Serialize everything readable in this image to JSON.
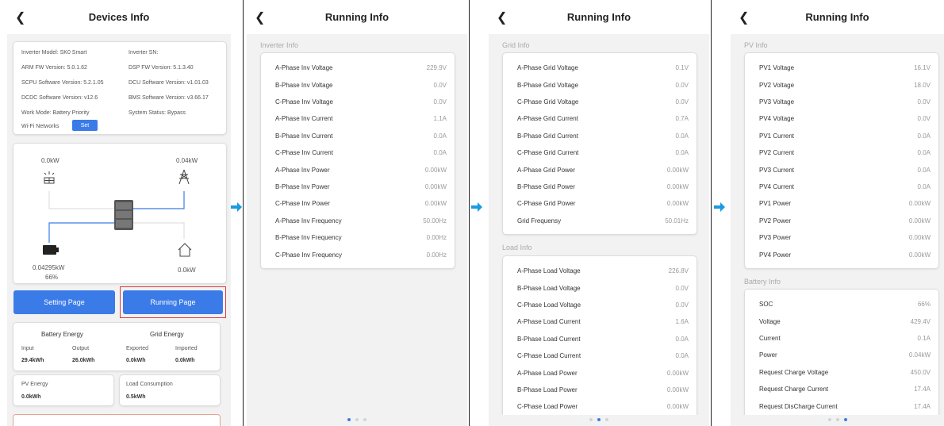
{
  "colors": {
    "accent": "#3b7be8",
    "highlight_border": "#e03a3a",
    "arrow": "#1a9be0"
  },
  "devices": {
    "title": "Devices Info",
    "info": {
      "inverter_model": "Inverter Model: SK0 Smart",
      "inverter_sn": "Inverter SN:",
      "arm_fw": "ARM FW Version: 5.0.1.62",
      "dsp_fw": "DSP FW Version: 5.1.3.40",
      "scpu_sw": "SCPU Software Version: 5.2.1.05",
      "dcu_sw": "DCU Software Version: v1.01.03",
      "dcdc_sw": "DCDC Software Version: v12.6",
      "bms_sw": "BMS Software Version: v3.66.17",
      "work_mode": "Work Mode: Battery Priority",
      "system_status": "System Status: Bypass",
      "wifi_label": "Wi-Fi Networks",
      "wifi_set": "Set"
    },
    "flow": {
      "pv_power": "0.0kW",
      "grid_power": "0.04kW",
      "battery_power": "0.04295kW",
      "battery_soc": "66%",
      "load_power": "0.0kW"
    },
    "setting_btn": "Setting Page",
    "running_btn": "Running Page",
    "battery_energy": {
      "title": "Battery Energy",
      "input_label": "Input",
      "output_label": "Output",
      "input_value": "29.4kWh",
      "output_value": "26.0kWh"
    },
    "grid_energy": {
      "title": "Grid Energy",
      "exported_label": "Exported",
      "imported_label": "Imported",
      "exported_value": "0.0kWh",
      "imported_value": "0.0kWh"
    },
    "pv_energy": {
      "label": "PV Energy",
      "value": "0.0kWh"
    },
    "load_consumption": {
      "label": "Load Consumption",
      "value": "0.5kWh"
    }
  },
  "running1": {
    "title": "Running Info",
    "section": "Inverter Info",
    "rows": [
      {
        "label": "A-Phase Inv Voltage",
        "value": "229.9V"
      },
      {
        "label": "B-Phase Inv Voltage",
        "value": "0.0V"
      },
      {
        "label": "C-Phase Inv Voltage",
        "value": "0.0V"
      },
      {
        "label": "A-Phase Inv Current",
        "value": "1.1A"
      },
      {
        "label": "B-Phase Inv Current",
        "value": "0.0A"
      },
      {
        "label": "C-Phase Inv Current",
        "value": "0.0A"
      },
      {
        "label": "A-Phase Inv Power",
        "value": "0.00kW"
      },
      {
        "label": "B-Phase Inv Power",
        "value": "0.00kW"
      },
      {
        "label": "C-Phase Inv Power",
        "value": "0.00kW"
      },
      {
        "label": "A-Phase Inv Frequency",
        "value": "50.00Hz"
      },
      {
        "label": "B-Phase Inv Frequency",
        "value": "0.00Hz"
      },
      {
        "label": "C-Phase Inv Frequency",
        "value": "0.00Hz"
      }
    ]
  },
  "running2": {
    "title": "Running Info",
    "grid_section": "Grid Info",
    "grid_rows": [
      {
        "label": "A-Phase Grid Voltage",
        "value": "0.1V"
      },
      {
        "label": "B-Phase Grid Voltage",
        "value": "0.0V"
      },
      {
        "label": "C-Phase Grid Voltage",
        "value": "0.0V"
      },
      {
        "label": "A-Phase Grid Current",
        "value": "0.7A"
      },
      {
        "label": "B-Phase Grid Current",
        "value": "0.0A"
      },
      {
        "label": "C-Phase Grid Current",
        "value": "0.0A"
      },
      {
        "label": "A-Phase Grid Power",
        "value": "0.00kW"
      },
      {
        "label": "B-Phase Grid Power",
        "value": "0.00kW"
      },
      {
        "label": "C-Phase Grid Power",
        "value": "0.00kW"
      },
      {
        "label": "Grid Frequensy",
        "value": "50.01Hz"
      }
    ],
    "load_section": "Load Info",
    "load_rows": [
      {
        "label": "A-Phase Load Voltage",
        "value": "226.8V"
      },
      {
        "label": "B-Phase Load Voltage",
        "value": "0.0V"
      },
      {
        "label": "C-Phase Load Voltage",
        "value": "0.0V"
      },
      {
        "label": "A-Phase Load Current",
        "value": "1.6A"
      },
      {
        "label": "B-Phase Load Current",
        "value": "0.0A"
      },
      {
        "label": "C-Phase Load Current",
        "value": "0.0A"
      },
      {
        "label": "A-Phase Load Power",
        "value": "0.00kW"
      },
      {
        "label": "B-Phase Load Power",
        "value": "0.00kW"
      },
      {
        "label": "C-Phase Load Power",
        "value": "0.00kW"
      }
    ]
  },
  "running3": {
    "title": "Running Info",
    "pv_section": "PV Info",
    "pv_rows": [
      {
        "label": "PV1 Voltage",
        "value": "16.1V"
      },
      {
        "label": "PV2 Voltage",
        "value": "18.0V"
      },
      {
        "label": "PV3 Voltage",
        "value": "0.0V"
      },
      {
        "label": "PV4 Voltage",
        "value": "0.0V"
      },
      {
        "label": "PV1 Current",
        "value": "0.0A"
      },
      {
        "label": "PV2 Current",
        "value": "0.0A"
      },
      {
        "label": "PV3 Current",
        "value": "0.0A"
      },
      {
        "label": "PV4 Current",
        "value": "0.0A"
      },
      {
        "label": "PV1 Power",
        "value": "0.00kW"
      },
      {
        "label": "PV2 Power",
        "value": "0.00kW"
      },
      {
        "label": "PV3 Power",
        "value": "0.00kW"
      },
      {
        "label": "PV4 Power",
        "value": "0.00kW"
      }
    ],
    "battery_section": "Battery Info",
    "battery_rows": [
      {
        "label": "SOC",
        "value": "66%"
      },
      {
        "label": "Voltage",
        "value": "429.4V"
      },
      {
        "label": "Current",
        "value": "0.1A"
      },
      {
        "label": "Power",
        "value": "0.04kW"
      },
      {
        "label": "Request Charge Voltage",
        "value": "450.0V"
      },
      {
        "label": "Request Charge Current",
        "value": "17.4A"
      },
      {
        "label": "Request DisCharge Current",
        "value": "17.4A"
      }
    ]
  },
  "pager": {
    "active_page_1": 1,
    "active_page_2": 2,
    "active_page_3": 3
  }
}
